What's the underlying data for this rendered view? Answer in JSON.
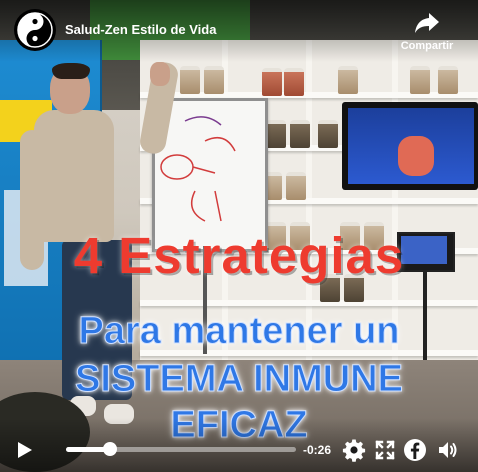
{
  "header": {
    "channel_name": "Salud-Zen Estilo de Vida",
    "share_label": "Compartir"
  },
  "overlay": {
    "line1": "4 Estrategias",
    "line2": "Para mantener un",
    "line3": "SISTEMA INMUNE",
    "line4": "EFICAZ"
  },
  "player": {
    "time_remaining": "-0:26",
    "progress": 0.19
  },
  "icons": {
    "logo": "yin-yang-logo",
    "share": "share-arrow-icon",
    "play": "play-icon",
    "settings": "gear-icon",
    "fullscreen": "fullscreen-icon",
    "facebook": "facebook-icon",
    "volume": "volume-icon"
  },
  "colors": {
    "headline_red": "#ee3b2f",
    "headline_blue": "#2f78e6"
  }
}
